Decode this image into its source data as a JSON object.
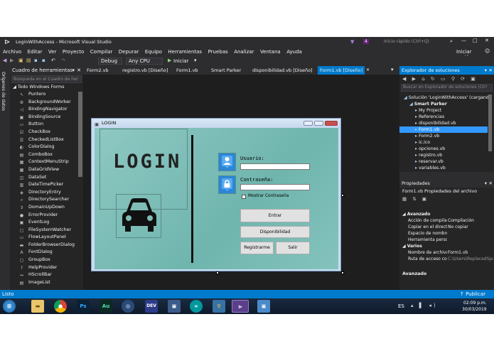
{
  "window": {
    "title": "LoginWithAccess - Microsoft Visual Studio",
    "quick_launch": "Inicio rápido (Ctrl+Q)",
    "notif_count": "4",
    "sign_in": "Iniciar sesión"
  },
  "menu": [
    "Archivo",
    "Editar",
    "Ver",
    "Proyecto",
    "Compilar",
    "Depurar",
    "Equipo",
    "Herramientas",
    "Pruebas",
    "Analizar",
    "Ventana",
    "Ayuda"
  ],
  "toolbar": {
    "config": "Debug",
    "platform": "Any CPU",
    "start": "Iniciar"
  },
  "side_label": "Orígenes de datos",
  "toolbox": {
    "title": "Cuadro de herramientas",
    "search_placeholder": "Búsqueda en el Cuadro de her",
    "group": "Todo Windows Forms",
    "items": [
      {
        "label": "Puntero",
        "icon": "pointer-icon",
        "glyph": "↖"
      },
      {
        "label": "BackgroundWorker",
        "icon": "worker-icon",
        "glyph": "⚙"
      },
      {
        "label": "BindingNavigator",
        "icon": "navigator-icon",
        "glyph": "◁"
      },
      {
        "label": "BindingSource",
        "icon": "binding-icon",
        "glyph": "▣"
      },
      {
        "label": "Button",
        "icon": "button-icon",
        "glyph": "▭"
      },
      {
        "label": "CheckBox",
        "icon": "checkbox-icon",
        "glyph": "☑"
      },
      {
        "label": "CheckedListBox",
        "icon": "checkedlist-icon",
        "glyph": "☰"
      },
      {
        "label": "ColorDialog",
        "icon": "color-icon",
        "glyph": "◐"
      },
      {
        "label": "ComboBox",
        "icon": "combobox-icon",
        "glyph": "▤"
      },
      {
        "label": "ContextMenuStrip",
        "icon": "contextmenu-icon",
        "glyph": "▦"
      },
      {
        "label": "DataGridView",
        "icon": "grid-icon",
        "glyph": "▦"
      },
      {
        "label": "DataSet",
        "icon": "dataset-icon",
        "glyph": "◫"
      },
      {
        "label": "DateTimePicker",
        "icon": "calendar-icon",
        "glyph": "▥"
      },
      {
        "label": "DirectoryEntry",
        "icon": "directory-icon",
        "glyph": "◈"
      },
      {
        "label": "DirectorySearcher",
        "icon": "search-icon",
        "glyph": "⌕"
      },
      {
        "label": "DomainUpDown",
        "icon": "updown-icon",
        "glyph": "⇕"
      },
      {
        "label": "ErrorProvider",
        "icon": "error-icon",
        "glyph": "●"
      },
      {
        "label": "EventLog",
        "icon": "eventlog-icon",
        "glyph": "▣"
      },
      {
        "label": "FileSystemWatcher",
        "icon": "watcher-icon",
        "glyph": "▢"
      },
      {
        "label": "FlowLayoutPanel",
        "icon": "flowpanel-icon",
        "glyph": "▭"
      },
      {
        "label": "FolderBrowserDialog",
        "icon": "folder-icon",
        "glyph": "▬"
      },
      {
        "label": "FontDialog",
        "icon": "font-icon",
        "glyph": "A"
      },
      {
        "label": "GroupBox",
        "icon": "groupbox-icon",
        "glyph": "▢"
      },
      {
        "label": "HelpProvider",
        "icon": "help-icon",
        "glyph": "?"
      },
      {
        "label": "HScrollBar",
        "icon": "hscroll-icon",
        "glyph": "↔"
      },
      {
        "label": "ImageList",
        "icon": "imagelist-icon",
        "glyph": "▤"
      }
    ]
  },
  "tabs": [
    {
      "label": "Form2.vb",
      "active": false
    },
    {
      "label": "registro.vb [Diseño]",
      "active": false
    },
    {
      "label": "Form1.vb",
      "active": false
    },
    {
      "label": "Smart Parker",
      "active": false
    },
    {
      "label": "disponibilidad.vb [Diseño]",
      "active": false
    },
    {
      "label": "Form1.vb [Diseño]",
      "active": true
    }
  ],
  "form": {
    "title": "LOGIN",
    "logo_text": "LOGIN",
    "usuario_label": "Usuario:",
    "contrasena_label": "Contraseña:",
    "show_password": "Mostrar Contraseña",
    "btn_entrar": "Entrar",
    "btn_disponibilidad": "Disponibilidad",
    "btn_registrarme": "Registrarme",
    "btn_salir": "Salir"
  },
  "solution": {
    "title": "Explorador de soluciones",
    "search_placeholder": "Buscar en Explorador de soluciones (Ctrl",
    "items": [
      {
        "label": "Solución 'LoginWithAccess' (cargand",
        "indent": 0
      },
      {
        "label": "Smart Parker",
        "indent": 1
      },
      {
        "label": "My Project",
        "indent": 2
      },
      {
        "label": "Referencias",
        "indent": 2
      },
      {
        "label": "disponibilidad.vb",
        "indent": 2
      },
      {
        "label": "Form1.vb",
        "indent": 2,
        "selected": true
      },
      {
        "label": "Form2.vb",
        "indent": 2
      },
      {
        "label": "ic.ico",
        "indent": 2
      },
      {
        "label": "opciones.vb",
        "indent": 2
      },
      {
        "label": "registro.vb",
        "indent": 2
      },
      {
        "label": "reservar.vb",
        "indent": 2
      },
      {
        "label": "variables.vb",
        "indent": 2
      }
    ]
  },
  "properties": {
    "title": "Propiedades",
    "object": "Form1.vb  Propiedades del archivo",
    "cat_advanced": "Avanzado",
    "rows": [
      {
        "name": "Acción de compila",
        "value": "Compilación"
      },
      {
        "name": "Copiar en el directo",
        "value": "No copiar"
      },
      {
        "name": "Espacio de nombre",
        "value": ""
      },
      {
        "name": "Herramienta perso",
        "value": ""
      }
    ],
    "cat_misc": "Varios",
    "rows2": [
      {
        "name": "Nombre de archivo",
        "value": "Form1.vb"
      },
      {
        "name": "Ruta de acceso con",
        "value": "C:\\Users\\ReplacedSpace"
      }
    ],
    "description": "Avanzado"
  },
  "status": {
    "left": "Listo",
    "publish": "Publicar"
  },
  "taskbar": {
    "lang": "ES",
    "time": "02:09 p.m.",
    "date": "30/03/2019"
  },
  "colors": {
    "accent": "#007acc",
    "vs_purple": "#68217a"
  }
}
